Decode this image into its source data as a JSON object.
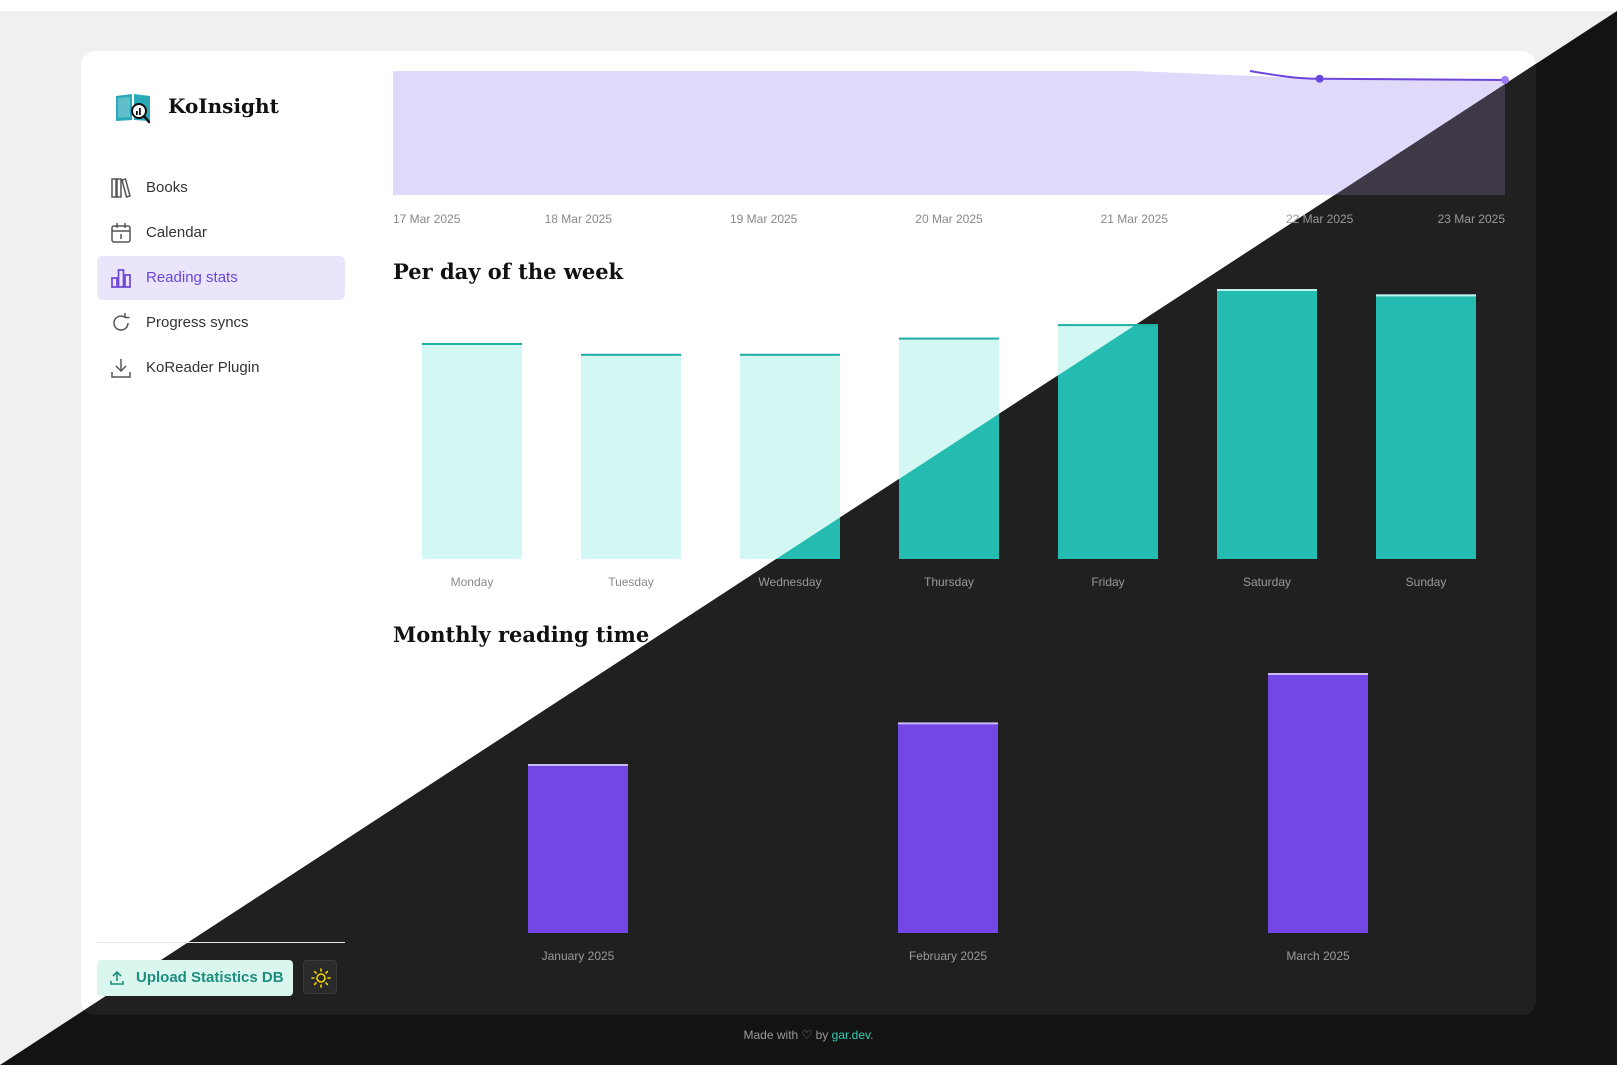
{
  "app": {
    "title": "KoInsight"
  },
  "sidebar": {
    "items": [
      {
        "label": "Books",
        "icon": "books-icon",
        "active": false
      },
      {
        "label": "Calendar",
        "icon": "calendar-icon",
        "active": false
      },
      {
        "label": "Reading stats",
        "icon": "bar-chart-icon",
        "active": true
      },
      {
        "label": "Progress syncs",
        "icon": "refresh-icon",
        "active": false
      },
      {
        "label": "KoReader Plugin",
        "icon": "download-icon",
        "active": false
      }
    ],
    "upload_label": "Upload Statistics DB",
    "upload_icon": "upload-icon",
    "theme_toggle_icon": "sun-icon"
  },
  "sections": {
    "per_day_title": "Per day of the week",
    "monthly_title": "Monthly reading time"
  },
  "footer": {
    "prefix": "Made with ♡ by ",
    "link": "gar.dev",
    "suffix": "."
  },
  "colors": {
    "accent_purple": "#7247e6",
    "accent_teal": "#24bbb0",
    "teal_light": "#d3f7f3",
    "area_fill": "#e0d9fa",
    "line": "#6b46d9"
  },
  "chart_data": [
    {
      "type": "area",
      "x": [
        "17 Mar 2025",
        "18 Mar 2025",
        "19 Mar 2025",
        "20 Mar 2025",
        "21 Mar 2025",
        "22 Mar 2025",
        "23 Mar 2025"
      ],
      "values": [
        100,
        100,
        100,
        100,
        100,
        94,
        93
      ]
    },
    {
      "type": "bar",
      "title": "Per day of the week",
      "categories": [
        "Monday",
        "Tuesday",
        "Wednesday",
        "Thursday",
        "Friday",
        "Saturday",
        "Sunday"
      ],
      "values": [
        80,
        76,
        76,
        82,
        87,
        100,
        98
      ]
    },
    {
      "type": "bar",
      "title": "Monthly reading time",
      "categories": [
        "January 2025",
        "February 2025",
        "March 2025"
      ],
      "values": [
        65,
        81,
        100
      ]
    }
  ]
}
